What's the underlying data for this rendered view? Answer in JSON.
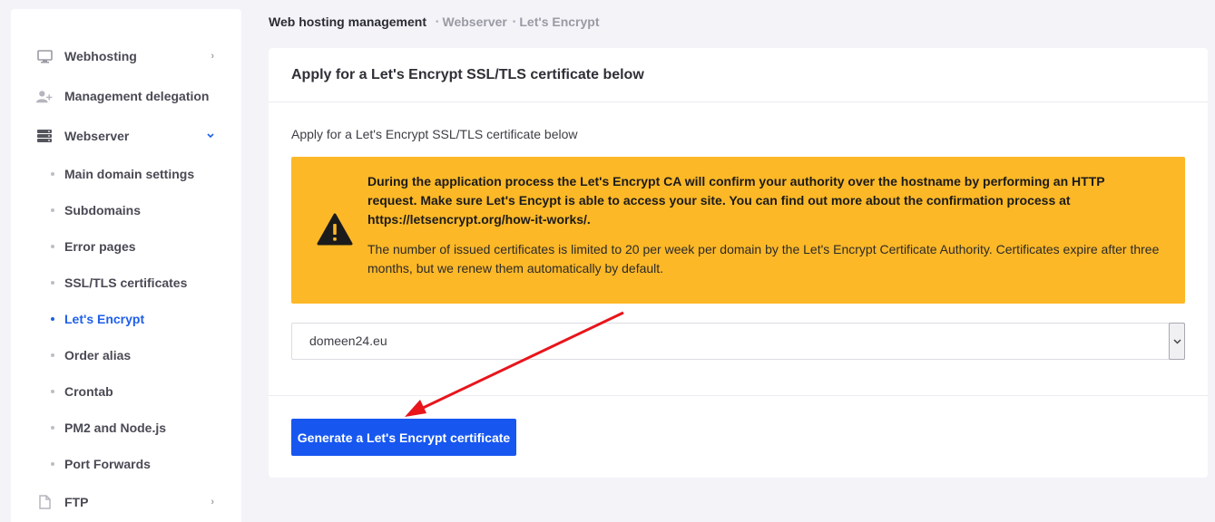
{
  "sidebar": {
    "top_items": [
      {
        "label": "Webhosting",
        "icon": "monitor-icon"
      },
      {
        "label": "Management delegation",
        "icon": "user-plus-icon"
      },
      {
        "label": "Webserver",
        "icon": "server-icon"
      }
    ],
    "sub_items": [
      {
        "label": "Main domain settings"
      },
      {
        "label": "Subdomains"
      },
      {
        "label": "Error pages"
      },
      {
        "label": "SSL/TLS certificates"
      },
      {
        "label": "Let's Encrypt"
      },
      {
        "label": "Order alias"
      },
      {
        "label": "Crontab"
      },
      {
        "label": "PM2 and Node.js"
      },
      {
        "label": "Port Forwards"
      }
    ],
    "bottom_items": [
      {
        "label": "FTP",
        "icon": "file-icon"
      }
    ],
    "active_item": "Let's Encrypt"
  },
  "breadcrumb": {
    "main": "Web hosting management",
    "items": [
      "Webserver",
      "Let's Encrypt"
    ]
  },
  "card": {
    "title": "Apply for a Let's Encrypt SSL/TLS certificate below",
    "intro": "Apply for a Let's Encrypt SSL/TLS certificate below",
    "alert": {
      "strong": "During the application process the Let's Encrypt CA will confirm your authority over the hostname by performing an HTTP request. Make sure Let's Encypt is able to access your site. You can find out more about the confirmation process at https://letsencrypt.org/how-it-works/.",
      "text": "The number of issued certificates is limited to 20 per week per domain by the Let's Encrypt Certificate Authority. Certificates expire after three months, but we renew them automatically by default."
    },
    "domain_select": {
      "value": "domeen24.eu"
    },
    "generate_button": "Generate a Let's Encrypt certificate"
  },
  "colors": {
    "accent": "#1757f0",
    "alert_bg": "#fdb827",
    "annotation_arrow": "#e8151b"
  }
}
